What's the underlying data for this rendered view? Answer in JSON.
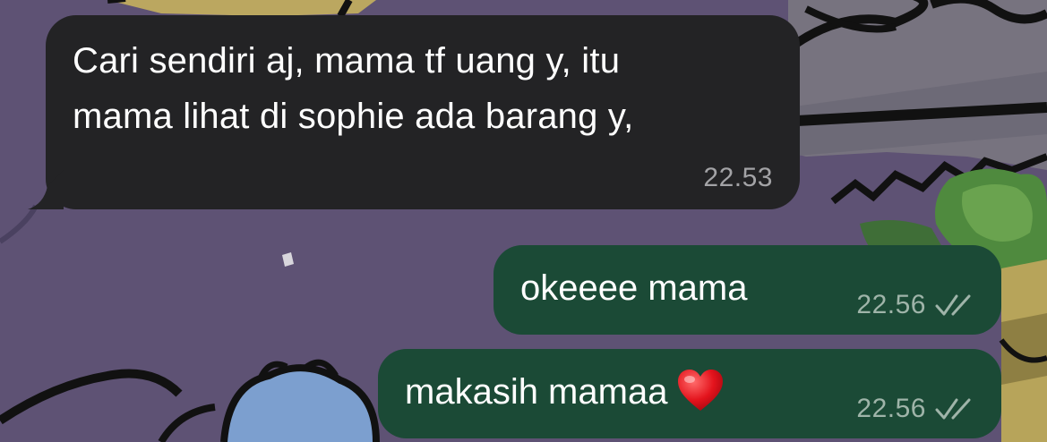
{
  "messages": [
    {
      "direction": "incoming",
      "lines": [
        "Cari sendiri aj, mama tf uang y, itu",
        "mama lihat di sophie ada barang y,"
      ],
      "time": "22.53"
    },
    {
      "direction": "outgoing",
      "text": "okeeee mama",
      "time": "22.56",
      "status_icon": "double-check-icon"
    },
    {
      "direction": "outgoing",
      "text": "makasih mamaa",
      "emoji": "heart-emoji",
      "time": "22.56",
      "status_icon": "double-check-icon"
    }
  ],
  "colors": {
    "incoming_bubble": "#232325",
    "outgoing_bubble": "#1b4a36",
    "wallpaper": "#5e5274",
    "timestamp": "#a3a3a6"
  }
}
